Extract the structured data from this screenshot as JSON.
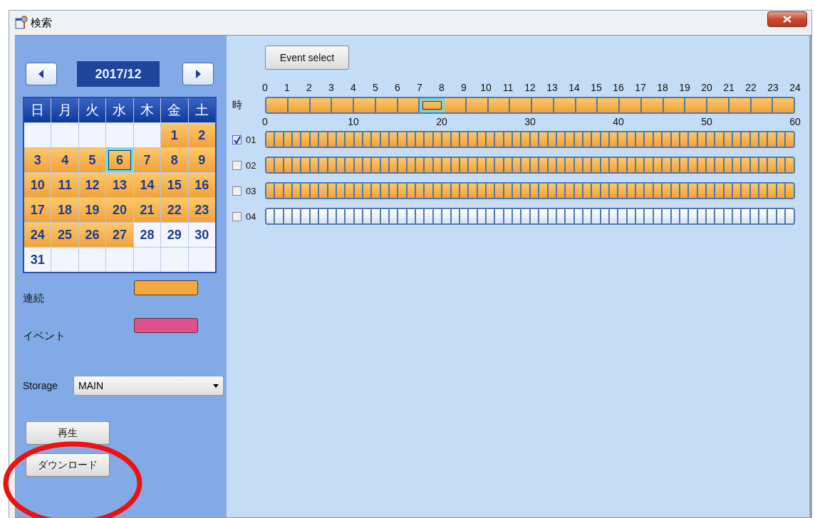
{
  "window": {
    "title": "検索"
  },
  "calendar": {
    "month": "2017/12",
    "weekdays": [
      "日",
      "月",
      "火",
      "水",
      "木",
      "金",
      "土"
    ],
    "weeks": [
      {
        "cells": [
          {
            "kind": "empty"
          },
          {
            "kind": "empty"
          },
          {
            "kind": "empty"
          },
          {
            "kind": "empty"
          },
          {
            "kind": "empty"
          },
          {
            "kind": "day",
            "label": "1",
            "recorded": true,
            "selected": false
          },
          {
            "kind": "day",
            "label": "2",
            "recorded": true,
            "selected": false
          }
        ]
      },
      {
        "cells": [
          {
            "kind": "day",
            "label": "3",
            "recorded": true,
            "selected": false
          },
          {
            "kind": "day",
            "label": "4",
            "recorded": true,
            "selected": false
          },
          {
            "kind": "day",
            "label": "5",
            "recorded": true,
            "selected": false
          },
          {
            "kind": "day",
            "label": "6",
            "recorded": true,
            "selected": true
          },
          {
            "kind": "day",
            "label": "7",
            "recorded": true,
            "selected": false
          },
          {
            "kind": "day",
            "label": "8",
            "recorded": true,
            "selected": false
          },
          {
            "kind": "day",
            "label": "9",
            "recorded": true,
            "selected": false
          }
        ]
      },
      {
        "cells": [
          {
            "kind": "day",
            "label": "10",
            "recorded": true,
            "selected": false
          },
          {
            "kind": "day",
            "label": "11",
            "recorded": true,
            "selected": false
          },
          {
            "kind": "day",
            "label": "12",
            "recorded": true,
            "selected": false
          },
          {
            "kind": "day",
            "label": "13",
            "recorded": true,
            "selected": false
          },
          {
            "kind": "day",
            "label": "14",
            "recorded": true,
            "selected": false
          },
          {
            "kind": "day",
            "label": "15",
            "recorded": true,
            "selected": false
          },
          {
            "kind": "day",
            "label": "16",
            "recorded": true,
            "selected": false
          }
        ]
      },
      {
        "cells": [
          {
            "kind": "day",
            "label": "17",
            "recorded": true,
            "selected": false
          },
          {
            "kind": "day",
            "label": "18",
            "recorded": true,
            "selected": false
          },
          {
            "kind": "day",
            "label": "19",
            "recorded": true,
            "selected": false
          },
          {
            "kind": "day",
            "label": "20",
            "recorded": true,
            "selected": false
          },
          {
            "kind": "day",
            "label": "21",
            "recorded": true,
            "selected": false
          },
          {
            "kind": "day",
            "label": "22",
            "recorded": true,
            "selected": false
          },
          {
            "kind": "day",
            "label": "23",
            "recorded": true,
            "selected": false
          }
        ]
      },
      {
        "cells": [
          {
            "kind": "day",
            "label": "24",
            "recorded": true,
            "selected": false
          },
          {
            "kind": "day",
            "label": "25",
            "recorded": true,
            "selected": false
          },
          {
            "kind": "day",
            "label": "26",
            "recorded": true,
            "selected": false
          },
          {
            "kind": "day",
            "label": "27",
            "recorded": true,
            "selected": false
          },
          {
            "kind": "day",
            "label": "28",
            "recorded": false,
            "selected": false
          },
          {
            "kind": "day",
            "label": "29",
            "recorded": false,
            "selected": false
          },
          {
            "kind": "day",
            "label": "30",
            "recorded": false,
            "selected": false
          }
        ]
      },
      {
        "cells": [
          {
            "kind": "day",
            "label": "31",
            "recorded": false,
            "selected": false
          },
          {
            "kind": "empty"
          },
          {
            "kind": "empty"
          },
          {
            "kind": "empty"
          },
          {
            "kind": "empty"
          },
          {
            "kind": "empty"
          },
          {
            "kind": "empty"
          }
        ]
      }
    ]
  },
  "legend": [
    {
      "label": "連続",
      "color": "#f5a93c"
    },
    {
      "label": "イベント",
      "color": "#e0508c"
    }
  ],
  "storage": {
    "label": "Storage",
    "value": "MAIN"
  },
  "buttons": [
    "再生",
    "ダウンロード"
  ],
  "timeline": {
    "event_button": "Event select",
    "hour_label": "時",
    "hour_ticks": [
      "0",
      "1",
      "2",
      "3",
      "4",
      "5",
      "6",
      "7",
      "8",
      "9",
      "10",
      "11",
      "12",
      "13",
      "14",
      "15",
      "16",
      "17",
      "18",
      "19",
      "20",
      "21",
      "22",
      "23",
      "24"
    ],
    "hours": [
      {
        "recorded": true,
        "selected": false
      },
      {
        "recorded": true,
        "selected": false
      },
      {
        "recorded": true,
        "selected": false
      },
      {
        "recorded": true,
        "selected": false
      },
      {
        "recorded": true,
        "selected": false
      },
      {
        "recorded": true,
        "selected": false
      },
      {
        "recorded": true,
        "selected": false
      },
      {
        "recorded": true,
        "selected": true
      },
      {
        "recorded": true,
        "selected": false
      },
      {
        "recorded": true,
        "selected": false
      },
      {
        "recorded": true,
        "selected": false
      },
      {
        "recorded": true,
        "selected": false
      },
      {
        "recorded": true,
        "selected": false
      },
      {
        "recorded": true,
        "selected": false
      },
      {
        "recorded": true,
        "selected": false
      },
      {
        "recorded": true,
        "selected": false
      },
      {
        "recorded": true,
        "selected": false
      },
      {
        "recorded": true,
        "selected": false
      },
      {
        "recorded": true,
        "selected": false
      },
      {
        "recorded": true,
        "selected": false
      },
      {
        "recorded": true,
        "selected": false
      },
      {
        "recorded": true,
        "selected": false
      },
      {
        "recorded": true,
        "selected": false
      },
      {
        "recorded": true,
        "selected": false
      }
    ],
    "minute_ticks": [
      "0",
      "10",
      "20",
      "30",
      "40",
      "50",
      "60"
    ],
    "channels": [
      {
        "label": "01",
        "checked": true,
        "recorded": true
      },
      {
        "label": "02",
        "checked": false,
        "recorded": true
      },
      {
        "label": "03",
        "checked": false,
        "recorded": true
      },
      {
        "label": "04",
        "checked": false,
        "recorded": false
      }
    ]
  }
}
